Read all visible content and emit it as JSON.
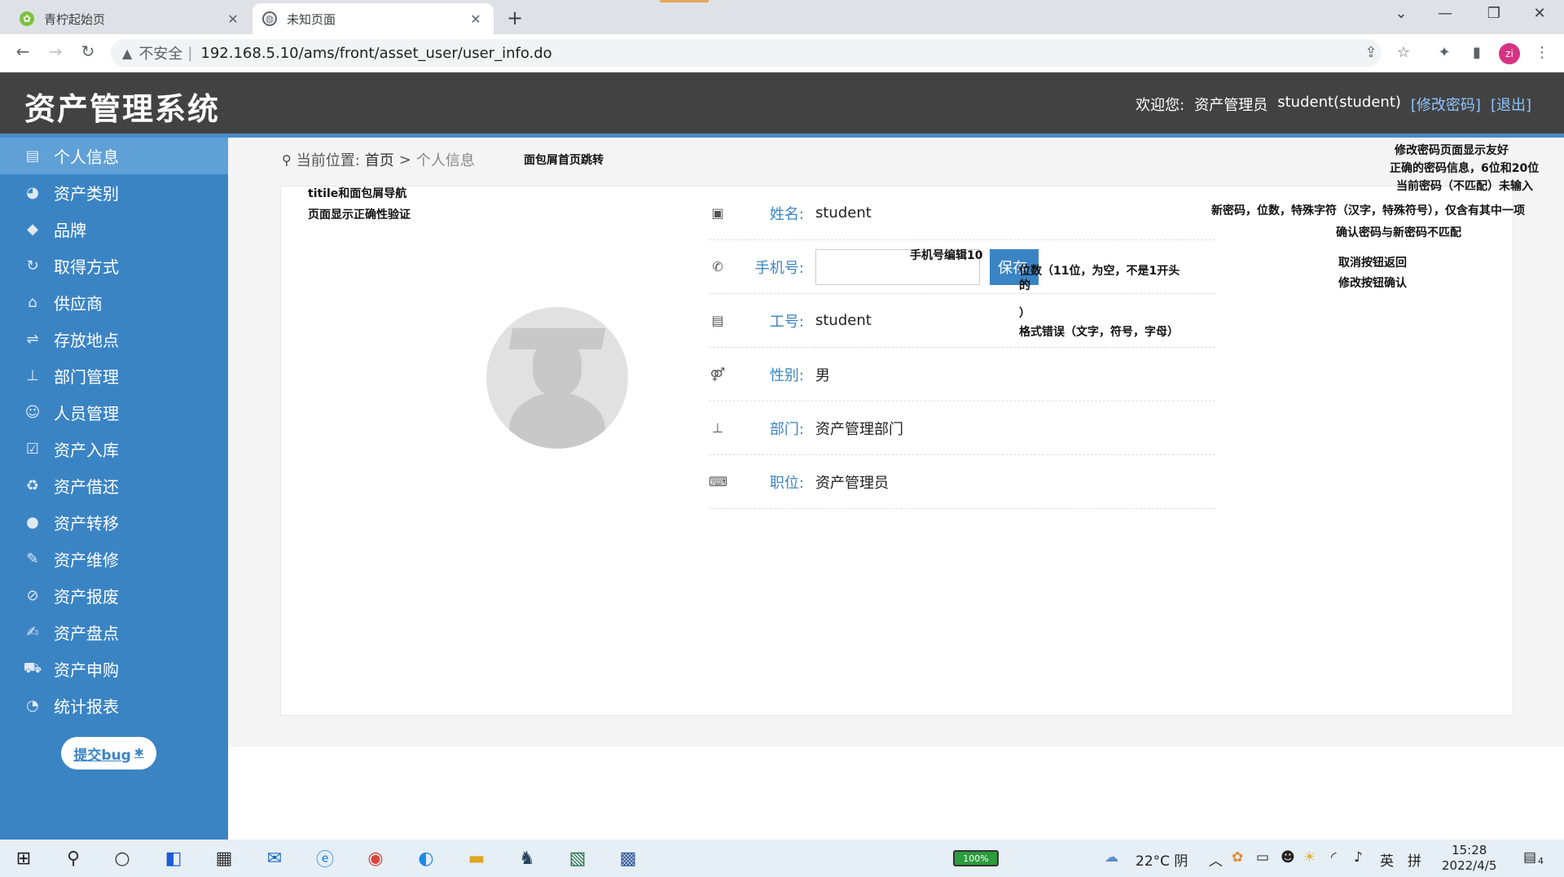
{
  "browser": {
    "tabs": [
      {
        "title": "青柠起始页",
        "active": false
      },
      {
        "title": "未知页面",
        "active": true
      }
    ],
    "security_label": "不安全",
    "url": "192.168.5.10/ams/front/asset_user/user_info.do",
    "profile_initials": "zi"
  },
  "app": {
    "title": "资产管理系统",
    "welcome": "欢迎您:",
    "role": "资产管理员",
    "user": "student(student)",
    "change_password": "[修改密码]",
    "logout": "[退出]"
  },
  "sidebar": {
    "items": [
      {
        "label": "个人信息",
        "icon": "id-card-icon",
        "glyph": "▤"
      },
      {
        "label": "资产类别",
        "icon": "pie-chart-icon",
        "glyph": "◕"
      },
      {
        "label": "品牌",
        "icon": "tags-icon",
        "glyph": "◆"
      },
      {
        "label": "取得方式",
        "icon": "refresh-icon",
        "glyph": "↻"
      },
      {
        "label": "供应商",
        "icon": "bank-icon",
        "glyph": "⌂"
      },
      {
        "label": "存放地点",
        "icon": "signpost-icon",
        "glyph": "⇌"
      },
      {
        "label": "部门管理",
        "icon": "sitemap-icon",
        "glyph": "⊥"
      },
      {
        "label": "人员管理",
        "icon": "users-icon",
        "glyph": "☺"
      },
      {
        "label": "资产入库",
        "icon": "check-square-icon",
        "glyph": "☑"
      },
      {
        "label": "资产借还",
        "icon": "recycle-icon",
        "glyph": "♻"
      },
      {
        "label": "资产转移",
        "icon": "user-icon",
        "glyph": "●"
      },
      {
        "label": "资产维修",
        "icon": "wrench-icon",
        "glyph": "✎"
      },
      {
        "label": "资产报废",
        "icon": "ban-icon",
        "glyph": "⊘"
      },
      {
        "label": "资产盘点",
        "icon": "edit-icon",
        "glyph": "✍"
      },
      {
        "label": "资产申购",
        "icon": "cart-icon",
        "glyph": "⛟"
      },
      {
        "label": "统计报表",
        "icon": "pie-chart-icon",
        "glyph": "◔"
      }
    ],
    "bug_button": "提交bug"
  },
  "breadcrumb": {
    "prefix": "当前位置:",
    "home": "首页",
    "separator": ">",
    "current": "个人信息"
  },
  "profile": {
    "name_label": "姓名:",
    "name": "student",
    "phone_label": "手机号:",
    "phone_value": "",
    "save_button": "保存",
    "job_no_label": "工号:",
    "job_no": "student",
    "gender_label": "性别:",
    "gender": "男",
    "dept_label": "部门:",
    "dept": "资产管理部门",
    "position_label": "职位:",
    "position": "资产管理员"
  },
  "annotations": {
    "breadcrumb_jump": "面包屑首页跳转",
    "title_nav_1": "titile和面包屑导航",
    "title_nav_2": "页面显示正确性验证",
    "phone_edit": "手机号编辑10",
    "phone_rules_1": "位数（11位，为空，不是1开头的",
    "phone_rules_2": "）",
    "phone_rules_3": "格式错误（文字，符号，字母）",
    "pwd_1": "修改密码页面显示友好",
    "pwd_2": "正确的密码信息，6位和20位",
    "pwd_3": "当前密码（不匹配）未输入",
    "pwd_4": "新密码，位数，特殊字符（汉字，特殊符号），仅含有其中一项",
    "pwd_5": "确认密码与新密码不匹配",
    "pwd_6": "取消按钮返回",
    "pwd_7": "修改按钮确认"
  },
  "taskbar": {
    "battery": "100%",
    "weather": "22°C 阴",
    "ime_lang": "英",
    "ime_mode": "拼",
    "time": "15:28",
    "date": "2022/4/5",
    "notifications": "4"
  }
}
